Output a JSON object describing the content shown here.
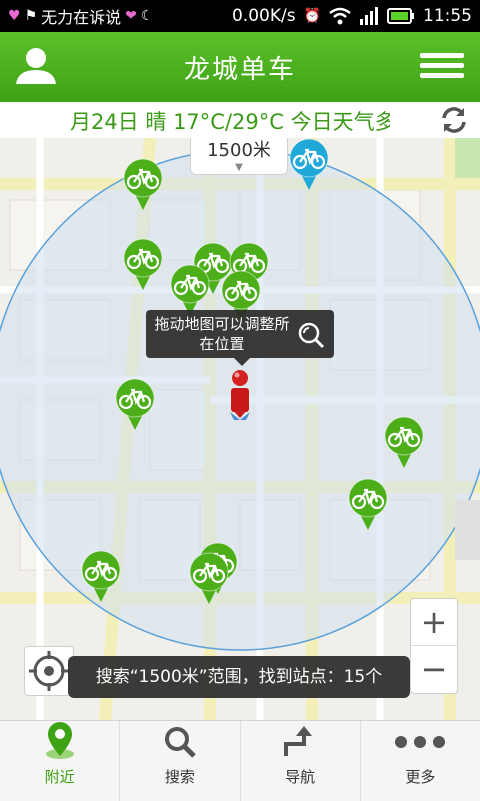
{
  "status_bar": {
    "notification_text": "无力在诉说",
    "network_speed": "0.00K/s",
    "time": "11:55"
  },
  "header": {
    "title": "龙城单车"
  },
  "weather": {
    "text": "月24日 晴 17°C/29°C 今日天气多"
  },
  "map": {
    "range_label": "1500米",
    "tooltip_text": "拖动地图可以调整所在位置",
    "toast_text": "搜索“1500米”范围，找到站点：15个",
    "zoom_in_label": "+",
    "zoom_out_label": "−"
  },
  "tabs": [
    {
      "label": "附近",
      "icon": "location-pin-icon",
      "active": true
    },
    {
      "label": "搜索",
      "icon": "search-icon",
      "active": false
    },
    {
      "label": "导航",
      "icon": "turn-arrow-icon",
      "active": false
    },
    {
      "label": "更多",
      "icon": "more-dots-icon",
      "active": false
    }
  ],
  "colors": {
    "brand_green": "#3ea315",
    "station_green": "#4caf1a",
    "station_blue": "#1fa8d8",
    "user_pin_red": "#c91a1a"
  }
}
